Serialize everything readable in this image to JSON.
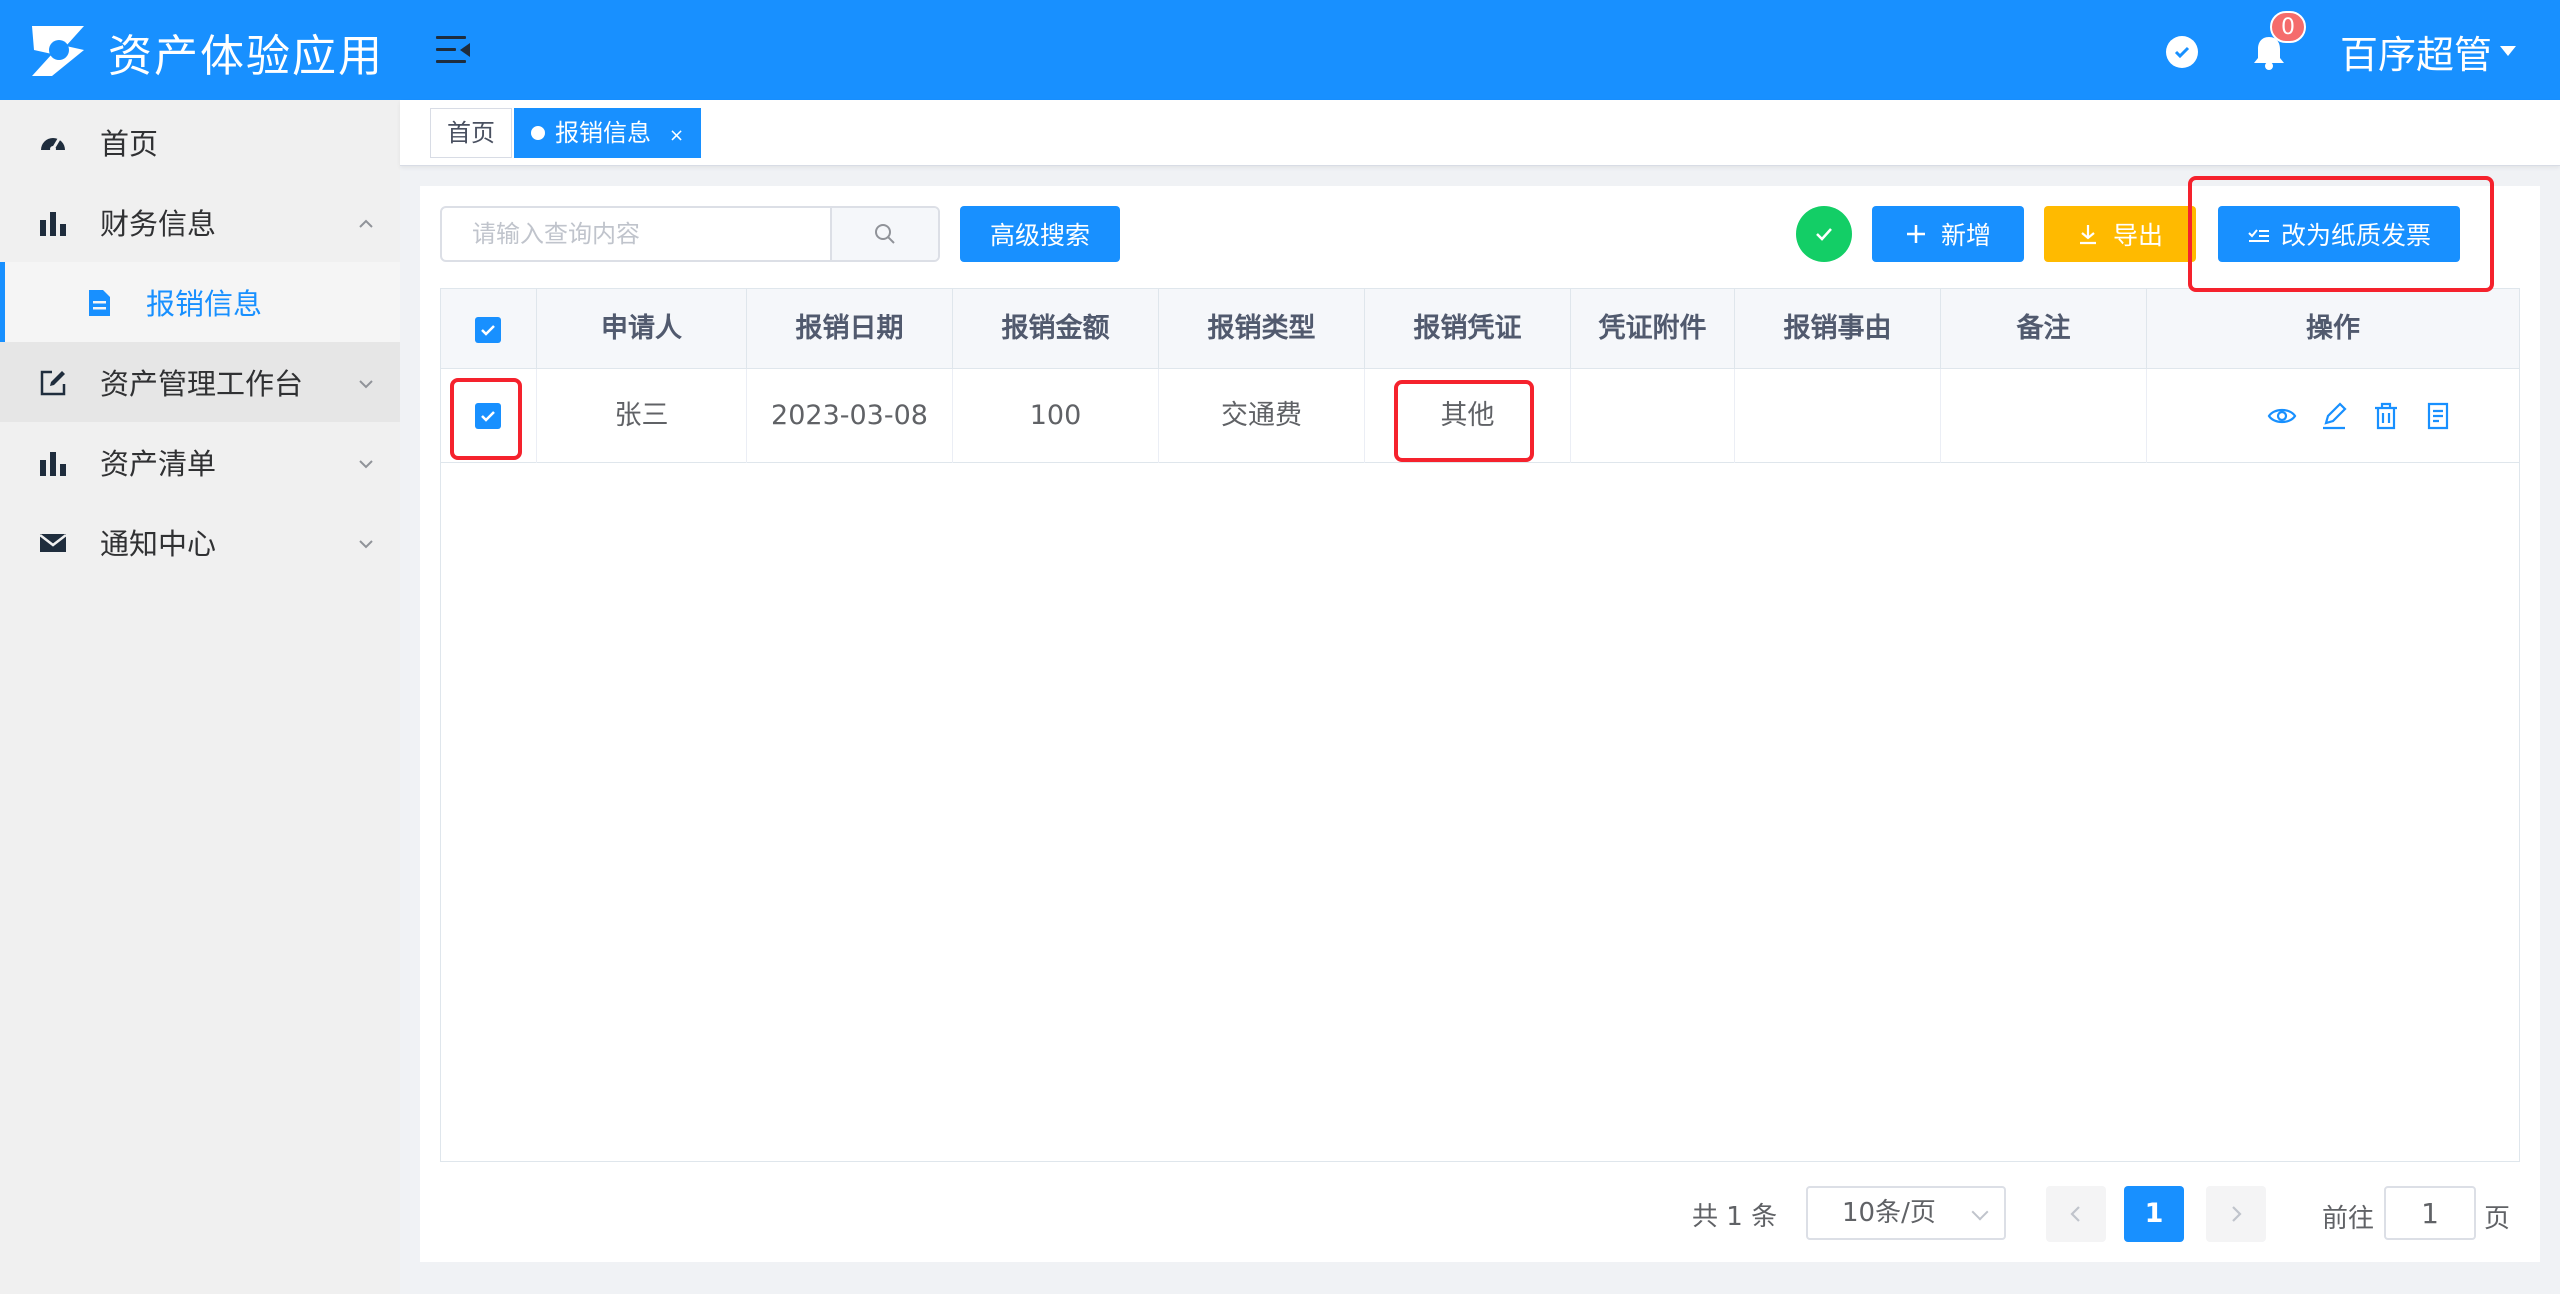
{
  "app": {
    "title": "资产体验应用",
    "brand_color": "#1890ff"
  },
  "header": {
    "notification_count": "0",
    "user_name": "百序超管",
    "icons": [
      "logo-icon",
      "menu-collapse-icon",
      "check-circle-icon",
      "bell-icon",
      "caret-down-icon"
    ]
  },
  "sidebar": {
    "items": [
      {
        "label": "首页",
        "icon": "dashboard-icon"
      },
      {
        "label": "财务信息",
        "icon": "bar-chart-icon",
        "expanded": true
      },
      {
        "label": "报销信息",
        "icon": "document-icon",
        "active": true
      },
      {
        "label": "资产管理工作台",
        "icon": "edit-icon"
      },
      {
        "label": "资产清单",
        "icon": "bar-chart-icon"
      },
      {
        "label": "通知中心",
        "icon": "mail-icon"
      }
    ]
  },
  "tabs": [
    {
      "label": "首页"
    },
    {
      "label": "报销信息",
      "active": true,
      "close": "×"
    }
  ],
  "toolbar": {
    "search_placeholder": "请输入查询内容",
    "advanced_search": "高级搜索",
    "add": "新增",
    "export": "导出",
    "to_paper_invoice": "改为纸质发票"
  },
  "table": {
    "columns": [
      "申请人",
      "报销日期",
      "报销金额",
      "报销类型",
      "报销凭证",
      "凭证附件",
      "报销事由",
      "备注",
      "操作"
    ],
    "rows": [
      {
        "checked": true,
        "applicant": "张三",
        "date": "2023-03-08",
        "amount": "100",
        "type": "交通费",
        "voucher": "其他",
        "attachment": "",
        "reason": "",
        "remark": "",
        "actions": [
          "view-icon",
          "edit-icon",
          "delete-icon",
          "detail-icon"
        ]
      }
    ]
  },
  "pagination": {
    "total": "共 1 条",
    "page_size": "10条/页",
    "current_page": "1",
    "goto_label": "前往",
    "goto_value": "1",
    "goto_suffix": "页"
  }
}
